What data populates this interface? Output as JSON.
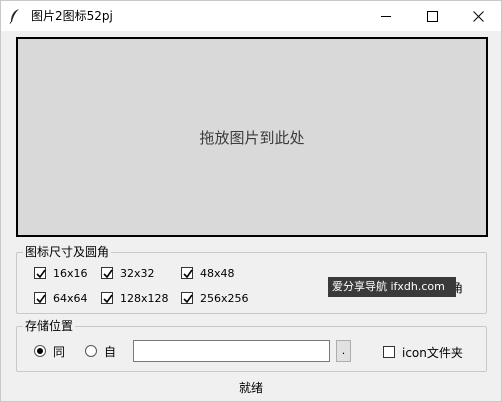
{
  "window": {
    "title": "图片2图标52pj",
    "app_icon": "feather-icon",
    "controls": [
      "minimize-icon",
      "maximize-icon",
      "close-icon"
    ]
  },
  "dropzone": {
    "text": "拖放图片到此处"
  },
  "size_group": {
    "title": "图标尺寸及圆角",
    "sizes": [
      {
        "label": "16x16",
        "checked": true
      },
      {
        "label": "32x32",
        "checked": true
      },
      {
        "label": "48x48",
        "checked": true
      },
      {
        "label": "64x64",
        "checked": true
      },
      {
        "label": "128x128",
        "checked": true
      },
      {
        "label": "256x256",
        "checked": true
      }
    ],
    "corner_label": "角"
  },
  "watermark": {
    "text": "爱分享导航 ifxdh.com"
  },
  "storage_group": {
    "title": "存储位置",
    "option_same": "同",
    "option_custom": "自",
    "selected": "同",
    "path_value": "",
    "browse_label": ".",
    "icon_folder_label": "icon文件夹",
    "icon_folder_checked": false
  },
  "status": {
    "text": "就绪"
  }
}
